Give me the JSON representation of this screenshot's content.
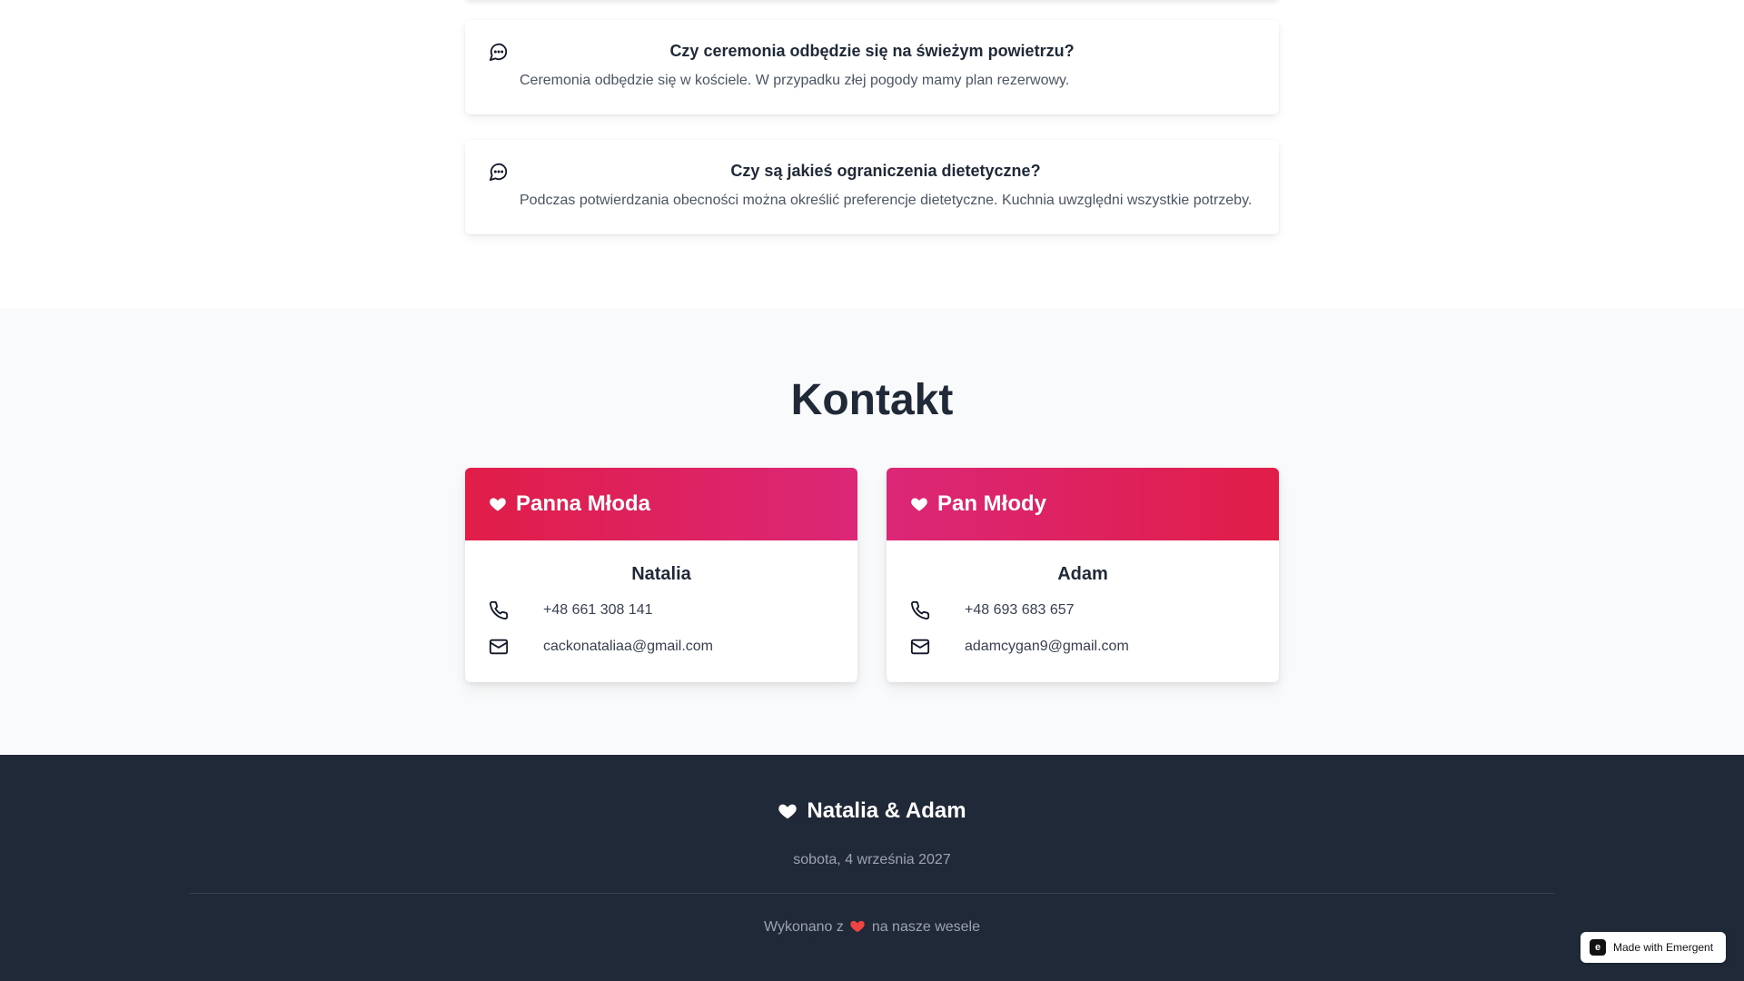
{
  "faq": {
    "items": [
      {
        "question": "Czy ceremonia odbędzie się na świeżym powietrzu?",
        "answer": "Ceremonia odbędzie się w kościele. W przypadku złej pogody mamy plan rezerwowy."
      },
      {
        "question": "Czy są jakieś ograniczenia dietetyczne?",
        "answer": "Podczas potwierdzania obecności można określić preferencje dietetyczne. Kuchnia uwzględni wszystkie potrzeby."
      }
    ],
    "icon": "message-circle-icon"
  },
  "contact": {
    "title": "Kontakt",
    "bride": {
      "heading": "Panna Młoda",
      "name": "Natalia",
      "phone": "+48 661 308 141",
      "email": "cackonataliaa@gmail.com"
    },
    "groom": {
      "heading": "Pan Młody",
      "name": "Adam",
      "phone": "+48 693 683 657",
      "email": "adamcygan9@gmail.com"
    },
    "accent_start": "#e11d48",
    "accent_end": "#db2777"
  },
  "footer": {
    "brand": "Natalia & Adam",
    "date": "sobota, 4 września 2027",
    "made_prefix": "Wykonano z",
    "made_suffix": "na nasze wesele",
    "background": "#1f2937"
  },
  "badge": {
    "label": "Made with Emergent"
  }
}
